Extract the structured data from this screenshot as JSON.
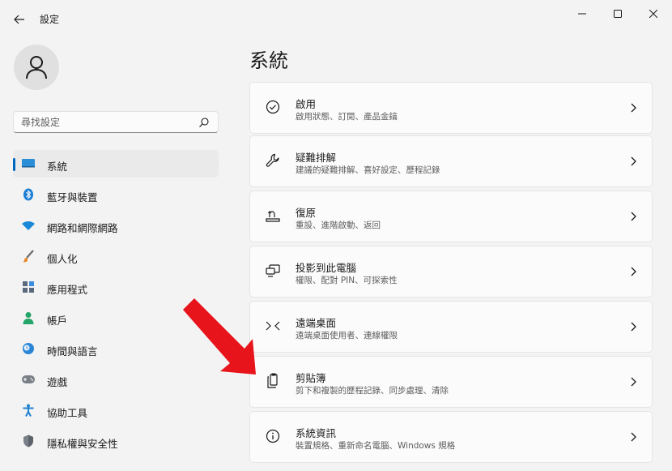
{
  "window": {
    "title": "設定",
    "back_icon": "arrow-left-icon",
    "minimize_icon": "minimize-icon",
    "maximize_icon": "maximize-icon",
    "close_icon": "close-icon"
  },
  "user": {
    "avatar_icon": "person-icon"
  },
  "search": {
    "placeholder": "尋找設定",
    "icon": "search-icon"
  },
  "sidebar": {
    "items": [
      {
        "label": "系統",
        "icon": "monitor-icon",
        "selected": true
      },
      {
        "label": "藍牙與裝置",
        "icon": "bluetooth-icon"
      },
      {
        "label": "網路和網際網路",
        "icon": "wifi-icon"
      },
      {
        "label": "個人化",
        "icon": "brush-icon"
      },
      {
        "label": "應用程式",
        "icon": "apps-icon"
      },
      {
        "label": "帳戶",
        "icon": "account-icon"
      },
      {
        "label": "時間與語言",
        "icon": "clock-globe-icon"
      },
      {
        "label": "遊戲",
        "icon": "gamepad-icon"
      },
      {
        "label": "協助工具",
        "icon": "accessibility-icon"
      },
      {
        "label": "隱私權與安全性",
        "icon": "shield-icon"
      }
    ]
  },
  "main": {
    "title": "系統",
    "cards": [
      {
        "title": "啟用",
        "subtitle": "啟用狀態、訂閱、產品金鑰",
        "icon": "check-circle-icon"
      },
      {
        "title": "疑難排解",
        "subtitle": "建議的疑難排解、喜好設定、歷程記錄",
        "icon": "wrench-icon"
      },
      {
        "title": "復原",
        "subtitle": "重設、進階啟動、返回",
        "icon": "recovery-icon"
      },
      {
        "title": "投影到此電腦",
        "subtitle": "權限、配對 PIN、可探索性",
        "icon": "project-icon"
      },
      {
        "title": "遠端桌面",
        "subtitle": "遠端桌面使用者、連線權限",
        "icon": "remote-desktop-icon"
      },
      {
        "title": "剪貼簿",
        "subtitle": "剪下和複製的歷程記錄、同步處理、清除",
        "icon": "clipboard-icon"
      },
      {
        "title": "系統資訊",
        "subtitle": "裝置規格、重新命名電腦、Windows 規格",
        "icon": "info-icon"
      }
    ]
  },
  "annotation": {
    "icon": "red-arrow-icon",
    "color": "#e8141b"
  },
  "colors": {
    "accent": "#0067c0",
    "background": "#f3f3f3",
    "card": "#fbfbfb"
  }
}
